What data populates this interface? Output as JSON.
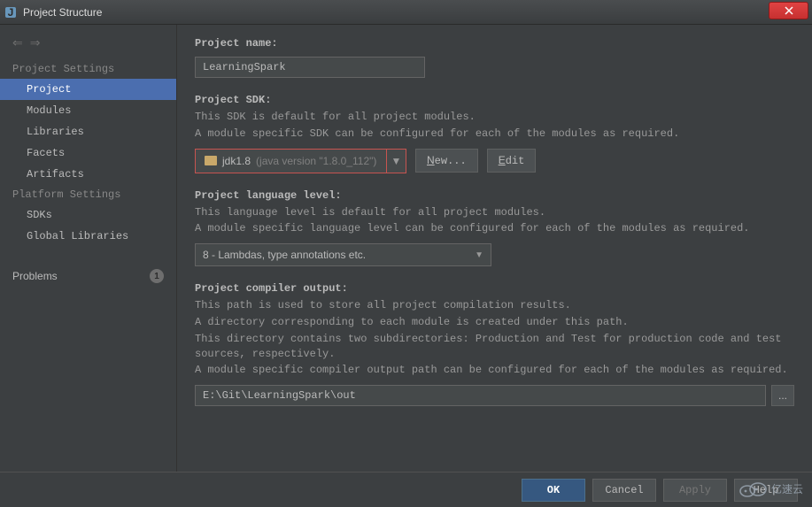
{
  "window": {
    "title": "Project Structure",
    "close_icon": "×"
  },
  "sidebar": {
    "section1": "Project Settings",
    "items1": [
      "Project",
      "Modules",
      "Libraries",
      "Facets",
      "Artifacts"
    ],
    "section2": "Platform Settings",
    "items2": [
      "SDKs",
      "Global Libraries"
    ],
    "problems_label": "Problems",
    "problems_count": "1"
  },
  "content": {
    "project_name": {
      "label": "Project name:",
      "value": "LearningSpark"
    },
    "project_sdk": {
      "label": "Project SDK:",
      "desc1": "This SDK is default for all project modules.",
      "desc2": "A module specific SDK can be configured for each of the modules as required.",
      "value": "jdk1.8",
      "version": "(java version \"1.8.0_112\")",
      "new_btn": "New...",
      "edit_btn": "Edit"
    },
    "language_level": {
      "label": "Project language level:",
      "desc1": "This language level is default for all project modules.",
      "desc2": "A module specific language level can be configured for each of the modules as required.",
      "value": "8 - Lambdas, type annotations etc."
    },
    "compiler_output": {
      "label": "Project compiler output:",
      "desc1": "This path is used to store all project compilation results.",
      "desc2": "A directory corresponding to each module is created under this path.",
      "desc3": "This directory contains two subdirectories: Production and Test for production code and test sources, respectively.",
      "desc4": "A module specific compiler output path can be configured for each of the modules as required.",
      "value": "E:\\Git\\LearningSpark\\out",
      "browse": "..."
    }
  },
  "buttons": {
    "ok": "OK",
    "cancel": "Cancel",
    "apply": "Apply",
    "help": "Help"
  },
  "watermark": {
    "text": "亿速云"
  }
}
